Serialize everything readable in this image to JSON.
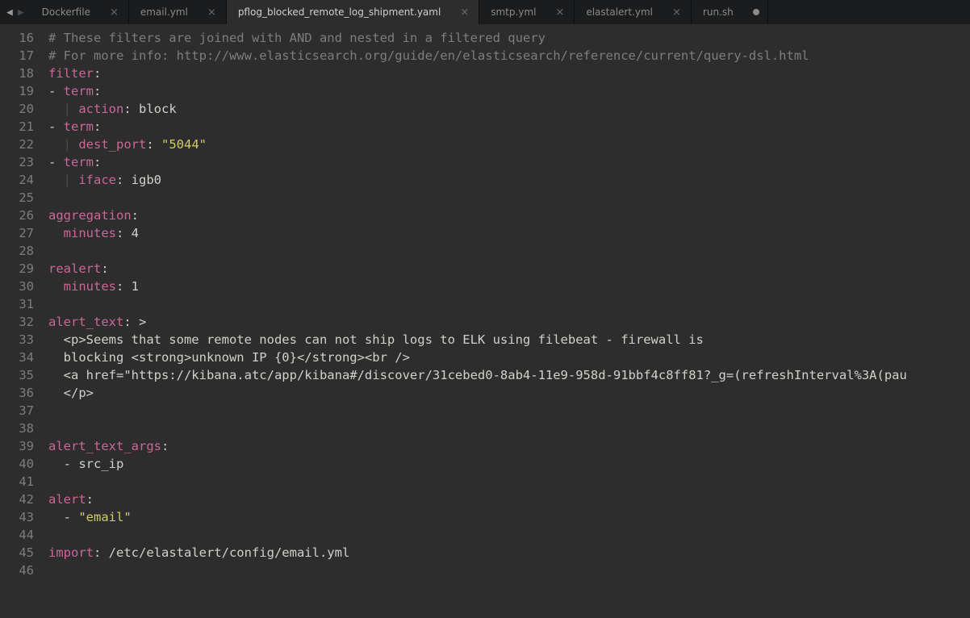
{
  "nav": {
    "back": "◀",
    "forward": "▶"
  },
  "tabs": [
    {
      "label": "Dockerfile",
      "active": false,
      "dirty": false
    },
    {
      "label": "email.yml",
      "active": false,
      "dirty": false
    },
    {
      "label": "pflog_blocked_remote_log_shipment.yaml",
      "active": true,
      "dirty": false
    },
    {
      "label": "smtp.yml",
      "active": false,
      "dirty": false
    },
    {
      "label": "elastalert.yml",
      "active": false,
      "dirty": false
    },
    {
      "label": "run.sh",
      "active": false,
      "dirty": true
    }
  ],
  "first_line_number": 16,
  "code_lines": [
    [
      {
        "t": "comment",
        "v": "# These filters are joined with AND and nested in a filtered query"
      }
    ],
    [
      {
        "t": "comment",
        "v": "# For more info: http://www.elasticsearch.org/guide/en/elasticsearch/reference/current/query-dsl.html"
      }
    ],
    [
      {
        "t": "key",
        "v": "filter"
      },
      {
        "t": "punct",
        "v": ":"
      }
    ],
    [
      {
        "t": "dash",
        "v": "- "
      },
      {
        "t": "key",
        "v": "term"
      },
      {
        "t": "punct",
        "v": ":"
      }
    ],
    [
      {
        "t": "guide",
        "v": "  | "
      },
      {
        "t": "key",
        "v": "action"
      },
      {
        "t": "punct",
        "v": ": "
      },
      {
        "t": "val",
        "v": "block"
      }
    ],
    [
      {
        "t": "dash",
        "v": "- "
      },
      {
        "t": "key",
        "v": "term"
      },
      {
        "t": "punct",
        "v": ":"
      }
    ],
    [
      {
        "t": "guide",
        "v": "  | "
      },
      {
        "t": "key",
        "v": "dest_port"
      },
      {
        "t": "punct",
        "v": ": "
      },
      {
        "t": "string",
        "v": "\"5044\""
      }
    ],
    [
      {
        "t": "dash",
        "v": "- "
      },
      {
        "t": "key",
        "v": "term"
      },
      {
        "t": "punct",
        "v": ":"
      }
    ],
    [
      {
        "t": "guide",
        "v": "  | "
      },
      {
        "t": "key",
        "v": "iface"
      },
      {
        "t": "punct",
        "v": ": "
      },
      {
        "t": "val",
        "v": "igb0"
      }
    ],
    [],
    [
      {
        "t": "key",
        "v": "aggregation"
      },
      {
        "t": "punct",
        "v": ":"
      }
    ],
    [
      {
        "t": "guide",
        "v": "  "
      },
      {
        "t": "key",
        "v": "minutes"
      },
      {
        "t": "punct",
        "v": ": "
      },
      {
        "t": "num",
        "v": "4"
      }
    ],
    [],
    [
      {
        "t": "key",
        "v": "realert"
      },
      {
        "t": "punct",
        "v": ":"
      }
    ],
    [
      {
        "t": "guide",
        "v": "  "
      },
      {
        "t": "key",
        "v": "minutes"
      },
      {
        "t": "punct",
        "v": ": "
      },
      {
        "t": "num",
        "v": "1"
      }
    ],
    [],
    [
      {
        "t": "key",
        "v": "alert_text"
      },
      {
        "t": "punct",
        "v": ": "
      },
      {
        "t": "val",
        "v": ">"
      }
    ],
    [
      {
        "t": "block",
        "v": "  <p>Seems that some remote nodes can not ship logs to ELK using filebeat - firewall is"
      }
    ],
    [
      {
        "t": "block",
        "v": "  blocking <strong>unknown IP {0}</strong><br />"
      }
    ],
    [
      {
        "t": "block",
        "v": "  <a href=\"https://kibana.atc/app/kibana#/discover/31cebed0-8ab4-11e9-958d-91bbf4c8ff81?_g=(refreshInterval%3A(pau"
      }
    ],
    [
      {
        "t": "block",
        "v": "  </p>"
      }
    ],
    [],
    [],
    [
      {
        "t": "key",
        "v": "alert_text_args"
      },
      {
        "t": "punct",
        "v": ":"
      }
    ],
    [
      {
        "t": "guide",
        "v": "  "
      },
      {
        "t": "dash",
        "v": "- "
      },
      {
        "t": "val",
        "v": "src_ip"
      }
    ],
    [],
    [
      {
        "t": "key",
        "v": "alert"
      },
      {
        "t": "punct",
        "v": ":"
      }
    ],
    [
      {
        "t": "guide",
        "v": "  "
      },
      {
        "t": "dash",
        "v": "- "
      },
      {
        "t": "string",
        "v": "\"email\""
      }
    ],
    [],
    [
      {
        "t": "key",
        "v": "import"
      },
      {
        "t": "punct",
        "v": ": "
      },
      {
        "t": "val",
        "v": "/etc/elastalert/config/email.yml"
      }
    ],
    []
  ]
}
